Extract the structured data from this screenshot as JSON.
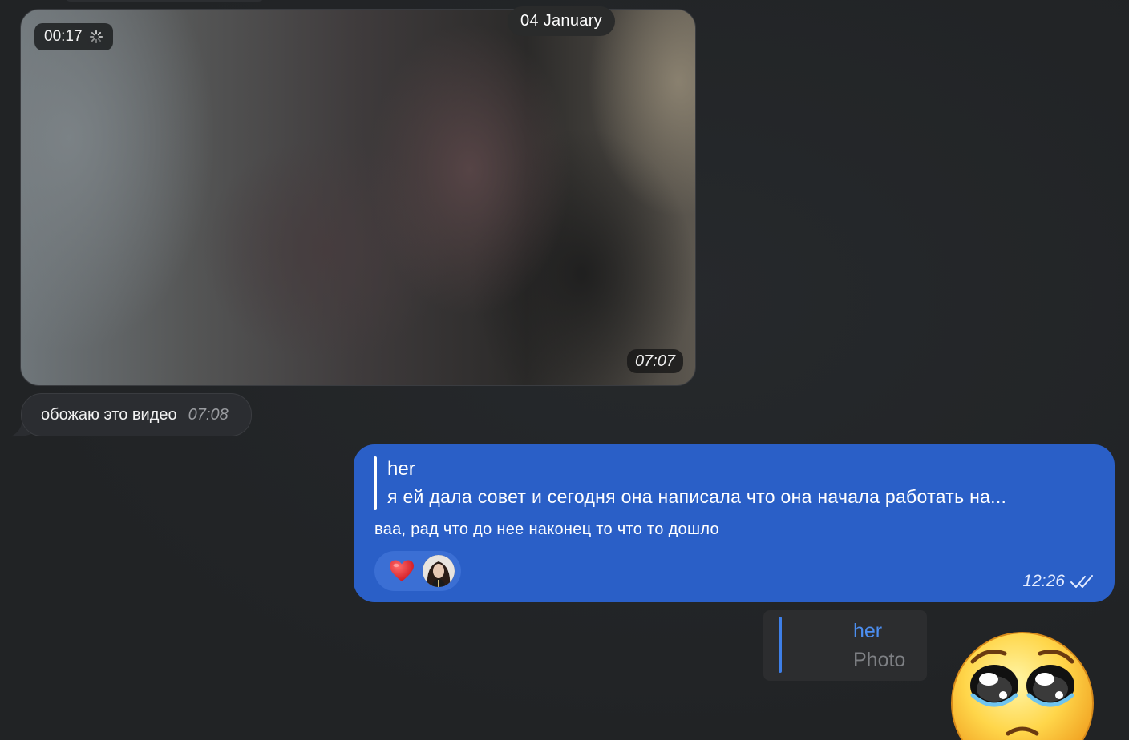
{
  "video_message": {
    "duration": "00:17",
    "time": "07:07"
  },
  "date_separator": "04 January",
  "incoming_message": {
    "text": "обожаю это видео",
    "time": "07:08"
  },
  "outgoing_message": {
    "reply_author": "her",
    "reply_text": "я ей дала совет и сегодня она написала что она начала работать на...",
    "text": "ваа, рад что до нее наконец то что то дошло",
    "time": "12:26",
    "reactions": [
      {
        "icon": "heart-icon",
        "color": "#e0242b"
      }
    ]
  },
  "reply_preview": {
    "author": "her",
    "type": "Photo"
  },
  "sticker": {
    "icon": "pleading-face-sticker"
  },
  "colors": {
    "background": "#222427",
    "outgoing_bubble": "#2a5fc7",
    "incoming_bubble": "#2b2d31",
    "accent_blue": "#3e7fe8"
  }
}
